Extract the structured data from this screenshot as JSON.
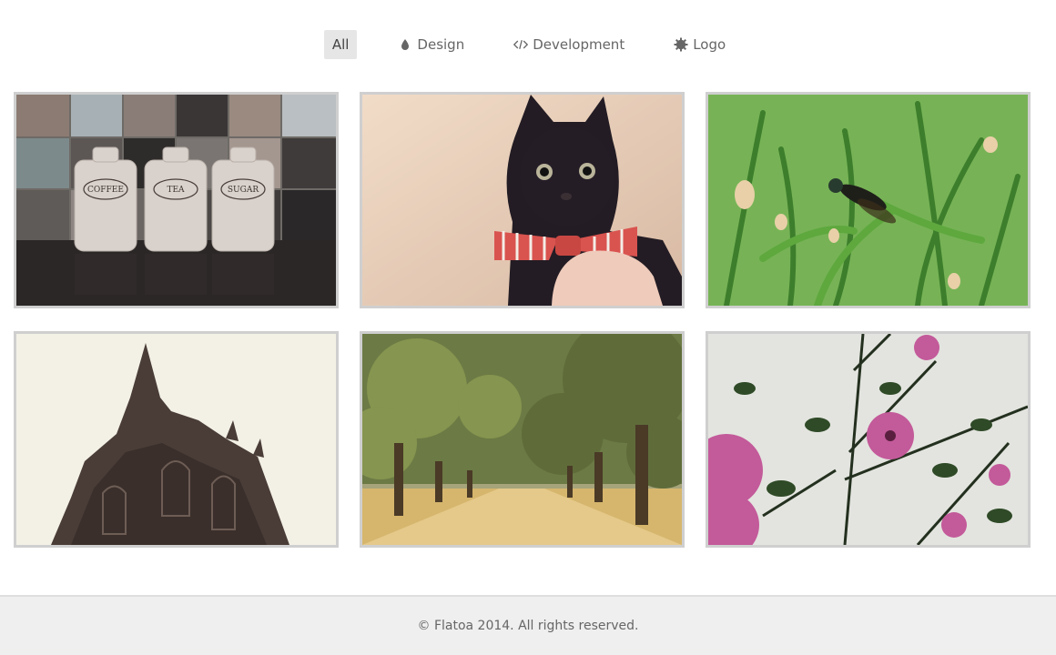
{
  "filters": [
    {
      "label": "All",
      "icon": "none",
      "active": true
    },
    {
      "label": "Design",
      "icon": "drop-icon",
      "active": false
    },
    {
      "label": "Development",
      "icon": "code-icon",
      "active": false
    },
    {
      "label": "Logo",
      "icon": "gear-icon",
      "active": false
    }
  ],
  "gallery": [
    {
      "subject": "kitchen-jars",
      "jar_labels": [
        "COFFEE",
        "TEA",
        "SUGAR"
      ]
    },
    {
      "subject": "black-kitten"
    },
    {
      "subject": "fly-on-grass"
    },
    {
      "subject": "cathedral-spire"
    },
    {
      "subject": "tree-avenue"
    },
    {
      "subject": "pink-flowers"
    }
  ],
  "footer": {
    "text": "© Flatoa 2014. All rights reserved."
  },
  "colors": {
    "active_filter_bg": "#e6e6e6",
    "thumb_border": "#cfcfcf",
    "footer_bg": "#efefef"
  }
}
